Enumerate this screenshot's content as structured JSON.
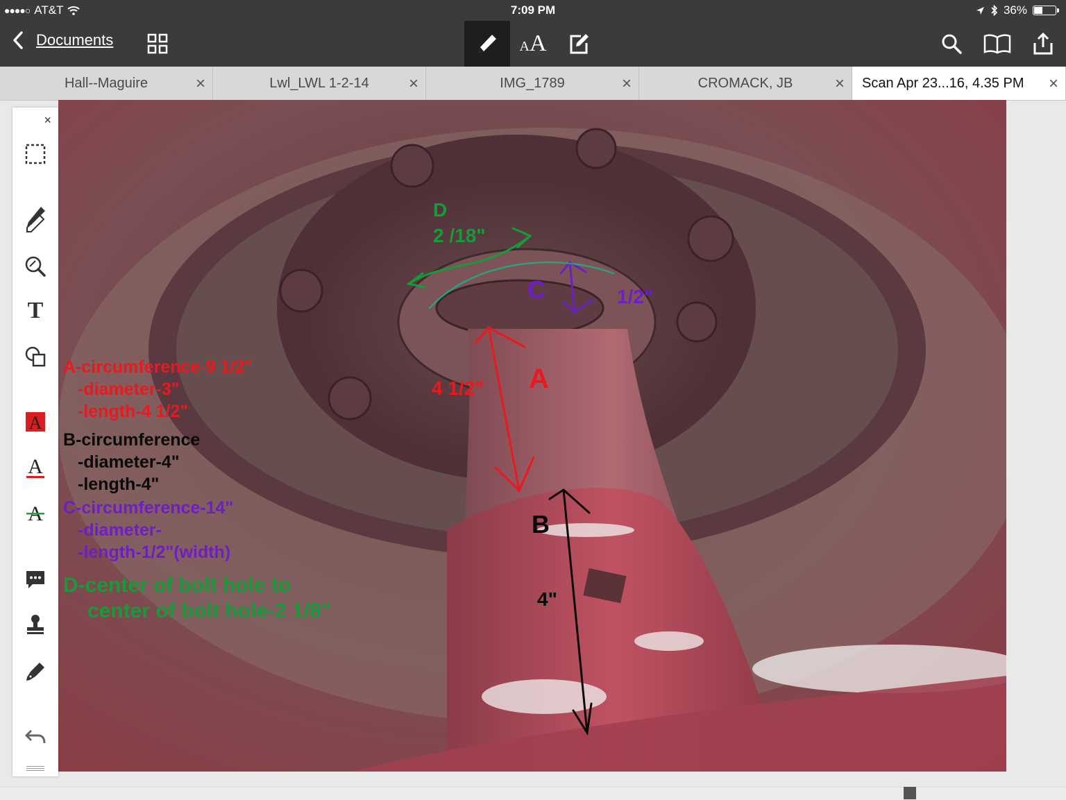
{
  "status": {
    "carrier": "AT&T",
    "time": "7:09 PM",
    "battery": "36%",
    "battery_level": 0.36
  },
  "toolbar": {
    "back_label": "Documents"
  },
  "tabs": [
    {
      "label": "Hall--Maguire"
    },
    {
      "label": "Lwl_LWL 1-2-14"
    },
    {
      "label": "IMG_1789"
    },
    {
      "label": "CROMACK, JB"
    },
    {
      "label": "Scan Apr 23...16, 4.35 PM"
    }
  ],
  "annotations": {
    "a_circ": "A-circumference-9 1/2\"",
    "a_diam": "-diameter-3\"",
    "a_len": "-length-4 1/2\"",
    "b_circ": "B-circumference",
    "b_diam": "-diameter-4\"",
    "b_len": "-length-4\"",
    "c_circ": "C-circumference-14\"",
    "c_diam": "-diameter-",
    "c_len": "-length-1/2\"(width)",
    "d_line1": "D-center of bolt hole to",
    "d_line2": "center of bolt hole-2 1/8\"",
    "label_a": "A",
    "label_b": "B",
    "label_c": "C",
    "label_d": "D",
    "dim_a": "4 1/2\"",
    "dim_b": "4\"",
    "dim_c": "1/2\"",
    "dim_d": "2 /18\""
  },
  "colors": {
    "red": "#e8191f",
    "black": "#0a0a0a",
    "purple": "#6d1fc2",
    "green": "#169a3a"
  }
}
